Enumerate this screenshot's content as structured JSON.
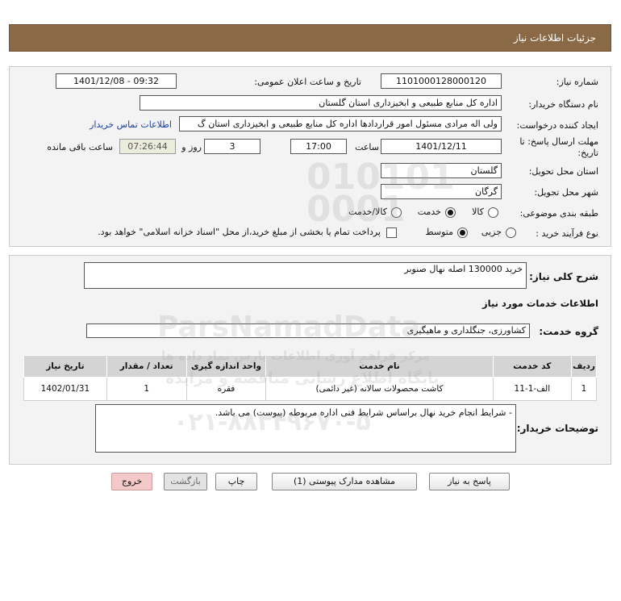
{
  "header": {
    "title": "جزئیات اطلاعات نیاز"
  },
  "form": {
    "need_number_label": "شماره نیاز:",
    "need_number_value": "1101000128000120",
    "announce_label": "تاریخ و ساعت اعلان عمومی:",
    "announce_value": "1401/12/08 - 09:32",
    "buyer_org_label": "نام دستگاه خریدار:",
    "buyer_org_value": "اداره کل منابع طبیعی و ابخیزداری استان گلستان",
    "requester_label": "ایجاد کننده درخواست:",
    "requester_value": "ولی اله مرادی مسئول امور قراردادها اداره کل منابع طبیعی و ابخیزداری استان گ",
    "contact_link": "اطلاعات تماس خریدار",
    "deadline_label_line1": "مهلت ارسال پاسخ: تا",
    "deadline_label_line2": "تاریخ:",
    "deadline_date": "1401/12/11",
    "time_label": "ساعت",
    "deadline_time": "17:00",
    "days_value": "3",
    "days_label": "روز و",
    "remaining_time": "07:26:44",
    "remaining_label": "ساعت باقی مانده",
    "province_label": "استان محل تحویل:",
    "province_value": "گلستان",
    "city_label": "شهر محل تحویل:",
    "city_value": "گرگان",
    "category_label": "طبقه بندی موضوعی:",
    "category_options": [
      "کالا",
      "خدمت",
      "کالا/خدمت"
    ],
    "category_selected": "خدمت",
    "process_label": "نوع فرآیند خرید :",
    "process_options": [
      "جزیی",
      "متوسط"
    ],
    "process_selected": "متوسط",
    "payment_note": "پرداخت تمام یا بخشی از مبلغ خرید،از محل \"اسناد خزانه اسلامی\" خواهد بود."
  },
  "details": {
    "summary_label": "شرح کلی نیاز:",
    "summary_value": "خرید 130000 اصله نهال صنوبر",
    "services_heading": "اطلاعات خدمات مورد نیاز",
    "service_group_label": "گروه خدمت:",
    "service_group_value": "کشاورزی، جنگلداری و ماهیگیری",
    "table": {
      "headers": [
        "ردیف",
        "کد خدمت",
        "نام خدمت",
        "واحد اندازه گیری",
        "تعداد / مقدار",
        "تاریخ نیاز"
      ],
      "rows": [
        [
          "1",
          "الف-1-11",
          "کاشت محصولات سالانه (غیر دائمی)",
          "فقره",
          "1",
          "1402/01/31"
        ]
      ]
    },
    "buyer_notes_label": "توضیحات خریدار:",
    "buyer_notes_value": "- شرایط انجام خرید نهال براساس شرایط فنی اداره مربوطه (پیوست) می باشد."
  },
  "buttons": {
    "reply": "پاسخ به نیاز",
    "attachments": "مشاهده مدارک پیوستی (1)",
    "print": "چاپ",
    "back": "بازگشت",
    "exit": "خروج"
  },
  "watermark": {
    "brand": "ParsNamadData",
    "tagline": "مرکز فراهم آوری اطلاعات پارس نماد داده ها",
    "tagline2": "پایگاه اطلاع رسانی مناقصه و مزایده",
    "phone": "۰۲۱-۸۸۳۴۹۶۷۰-۵"
  }
}
